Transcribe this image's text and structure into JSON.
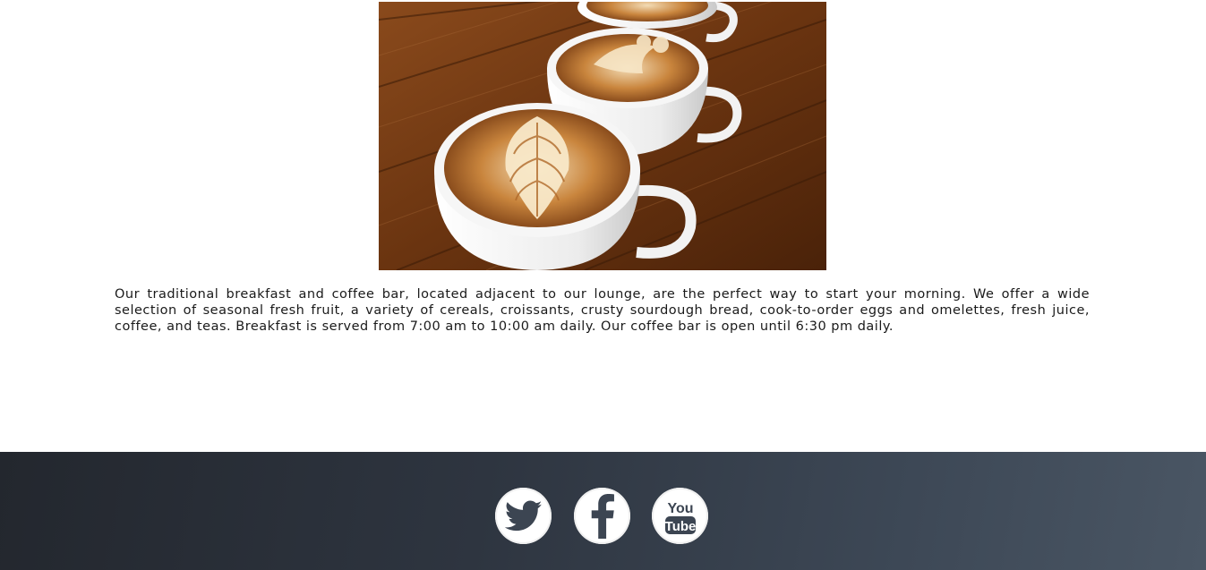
{
  "hero": {
    "image": "latte-art-coffee-cups-on-wooden-table"
  },
  "content": {
    "description": "Our traditional breakfast and coffee bar, located adjacent to our lounge, are the perfect way to start your morning. We offer a wide selection of seasonal fresh fruit, a variety of cereals, croissants, crusty sourdough bread, cook-to-order eggs and omelettes, fresh juice, coffee, and teas. Breakfast is served from 7:00 am to 10:00 am daily. Our coffee bar is open until 6:30 pm daily."
  },
  "footer": {
    "social": [
      {
        "icon": "twitter-icon"
      },
      {
        "icon": "facebook-icon"
      },
      {
        "icon": "youtube-icon",
        "text_line1": "You",
        "text_line2": "Tube"
      }
    ]
  },
  "colors": {
    "footer_dark": "#23272e",
    "footer_light": "#4a5664",
    "icon_fill": "#3c4552",
    "text": "#1a1a1a"
  }
}
